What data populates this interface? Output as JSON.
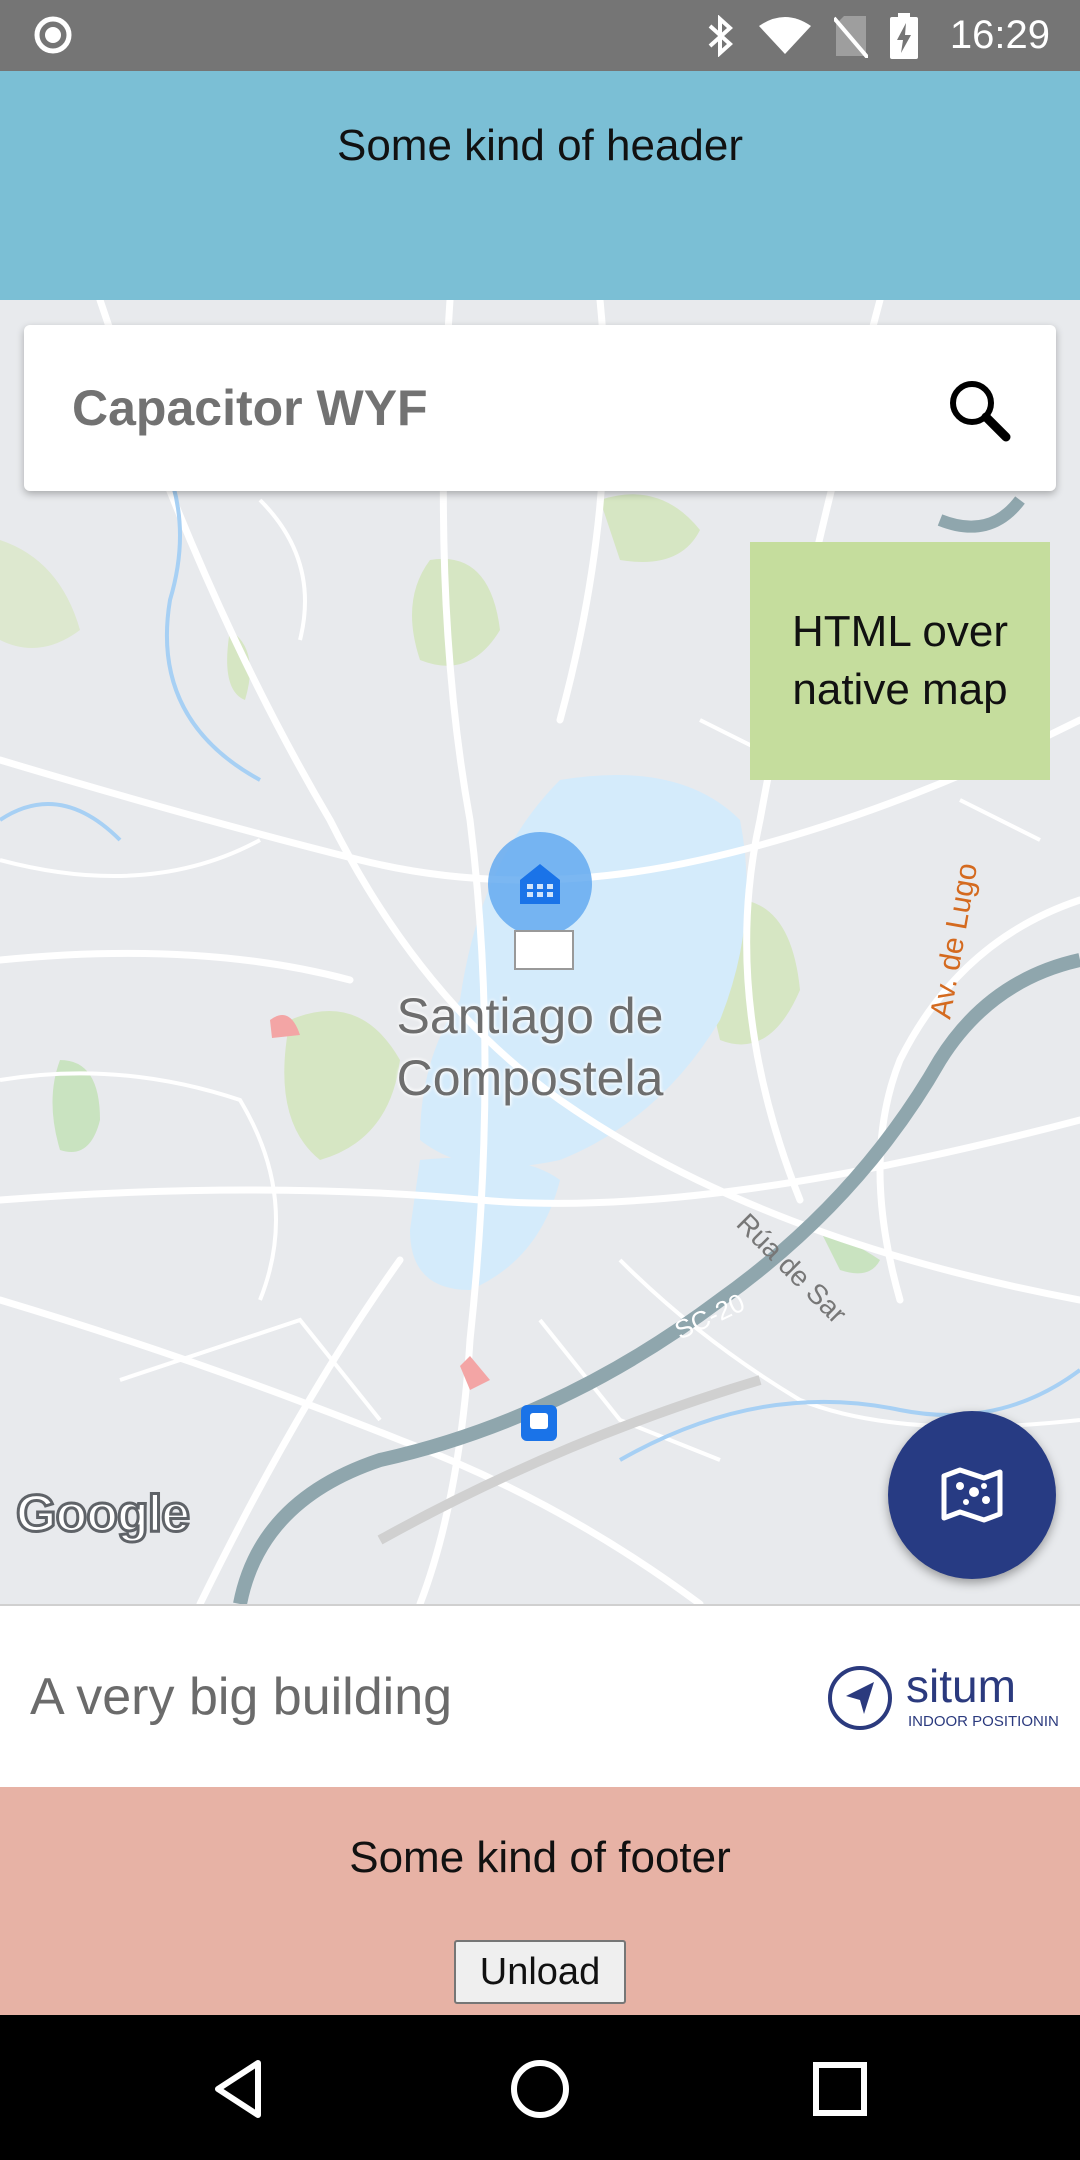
{
  "status_bar": {
    "time": "16:29",
    "icons": [
      "radio-button-icon",
      "bluetooth-icon",
      "wifi-icon",
      "no-sim-icon",
      "battery-charging-icon"
    ]
  },
  "header": {
    "title": "Some kind of header",
    "background": "#7bbfd5"
  },
  "search": {
    "placeholder": "Capacitor WYF",
    "icon": "search-icon"
  },
  "map": {
    "overlay_text": "HTML over native map",
    "city_label_line1": "Santiago de",
    "city_label_line2": "Compostela",
    "road_label_1": "Av. de Lugo",
    "road_label_2": "Rúa de Sar",
    "road_label_3": "SC-20",
    "attribution": "Google",
    "overlay_color": "#c5dd9d"
  },
  "fab": {
    "icon": "map-icon",
    "color": "#273b83"
  },
  "info_panel": {
    "building_name": "A very big building",
    "brand_name": "situm",
    "brand_tagline": "INDOOR POSITIONING"
  },
  "footer": {
    "title": "Some kind of footer",
    "button_label": "Unload",
    "background": "#e7b2a5"
  },
  "nav_bar": {
    "icons": [
      "back-icon",
      "home-icon",
      "recents-icon"
    ]
  }
}
